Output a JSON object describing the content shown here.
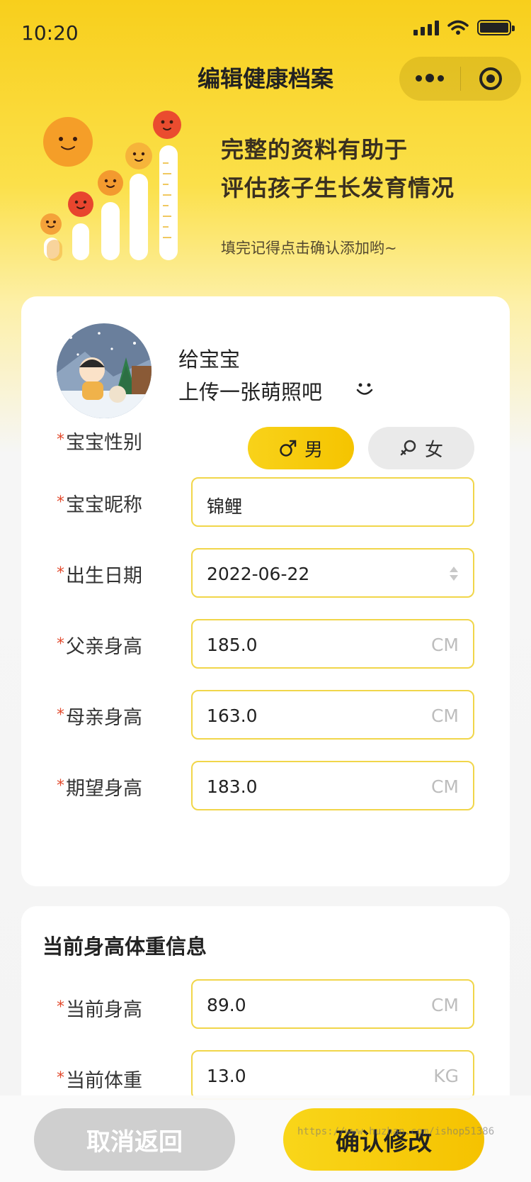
{
  "status_bar": {
    "time": "10:20"
  },
  "nav": {
    "title": "编辑健康档案"
  },
  "hero": {
    "headline_line1": "完整的资料有助于",
    "headline_line2": "评估孩子生长发育情况",
    "subtext": "填完记得点击确认添加哟~"
  },
  "profile": {
    "upload_line1": "给宝宝",
    "upload_line2": "上传一张萌照吧",
    "gender": {
      "label": "宝宝性别",
      "male": "男",
      "female": "女",
      "selected": "男"
    },
    "nickname": {
      "label": "宝宝昵称",
      "value": "锦鲤"
    },
    "birthday": {
      "label": "出生日期",
      "value": "2022-06-22"
    },
    "father_height": {
      "label": "父亲身高",
      "value": "185.0",
      "unit": "CM"
    },
    "mother_height": {
      "label": "母亲身高",
      "value": "163.0",
      "unit": "CM"
    },
    "expected_height": {
      "label": "期望身高",
      "value": "183.0",
      "unit": "CM"
    }
  },
  "current": {
    "title": "当前身高体重信息",
    "height": {
      "label": "当前身高",
      "value": "89.0",
      "unit": "CM"
    },
    "weight": {
      "label": "当前体重",
      "value": "13.0",
      "unit": "KG"
    }
  },
  "footer": {
    "cancel": "取消返回",
    "confirm": "确认修改"
  },
  "watermark": "https://www.huzhan.com/ishop51386",
  "colors": {
    "accent": "#f8d21a",
    "required_star": "#e24a2d",
    "field_border": "#f1d64a"
  }
}
